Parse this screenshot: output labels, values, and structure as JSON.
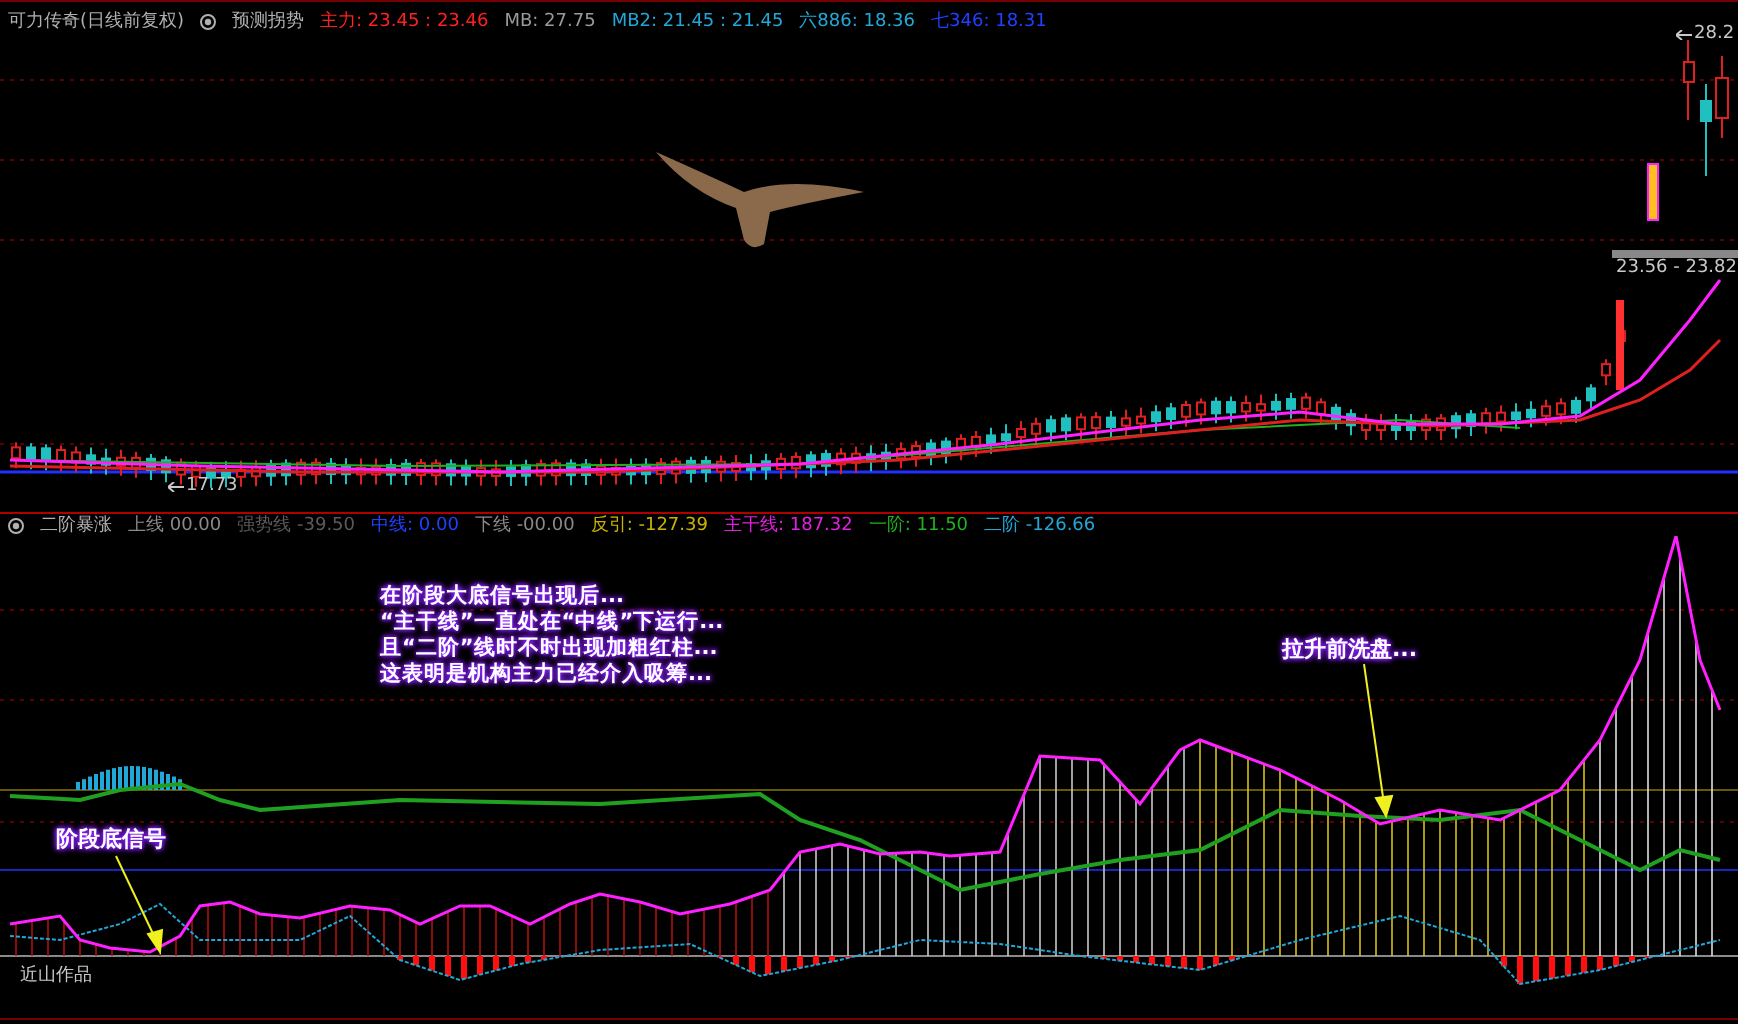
{
  "main_chart": {
    "title": "可力传奇(日线前复权)",
    "indicator": "预测拐势",
    "readouts": [
      {
        "label": "主力:",
        "value": "23.45 : 23.46",
        "color": "#ff2020"
      },
      {
        "label": "MB:",
        "value": "27.75",
        "color": "#9a9a9a"
      },
      {
        "label": "MB2:",
        "value": "21.45 : 21.45",
        "color": "#20a8d8"
      },
      {
        "label": "六886:",
        "value": "18.36",
        "color": "#20a8d8"
      },
      {
        "label": "七346:",
        "value": "18.31",
        "color": "#2040ff"
      }
    ],
    "low_label": "17.73",
    "high_label": "28.2",
    "range_label": "23.56 - 23.82"
  },
  "sub_chart": {
    "title": "二阶暴涨",
    "readouts": [
      {
        "label": "上线",
        "value": "00.00",
        "color": "#8a8a8a"
      },
      {
        "label": "强势线",
        "value": "-39.50",
        "color": "#5a5a5a"
      },
      {
        "label": "中线:",
        "value": "0.00",
        "color": "#2040ff"
      },
      {
        "label": "下线",
        "value": "-00.00",
        "color": "#8a8a8a"
      },
      {
        "label": "反引:",
        "value": "-127.39",
        "color": "#c8b400"
      },
      {
        "label": "主干线:",
        "value": "187.32",
        "color": "#e020e0"
      },
      {
        "label": "一阶:",
        "value": "11.50",
        "color": "#20b020"
      },
      {
        "label": "二阶",
        "value": "-126.66",
        "color": "#20a8d8"
      }
    ],
    "author_label": "近山作品"
  },
  "annotations": [
    {
      "kind": "paragraph",
      "lines": [
        "在阶段大底信号出现后...",
        "“主干线”一直处在“中线”下运行...",
        "且“二阶”线时不时出现加粗红柱...",
        "这表明是机构主力已经介入吸筹..."
      ]
    },
    {
      "kind": "callout",
      "lines": [
        "阶段底信号"
      ]
    },
    {
      "kind": "callout",
      "lines": [
        "拉升前洗盘..."
      ]
    }
  ]
}
